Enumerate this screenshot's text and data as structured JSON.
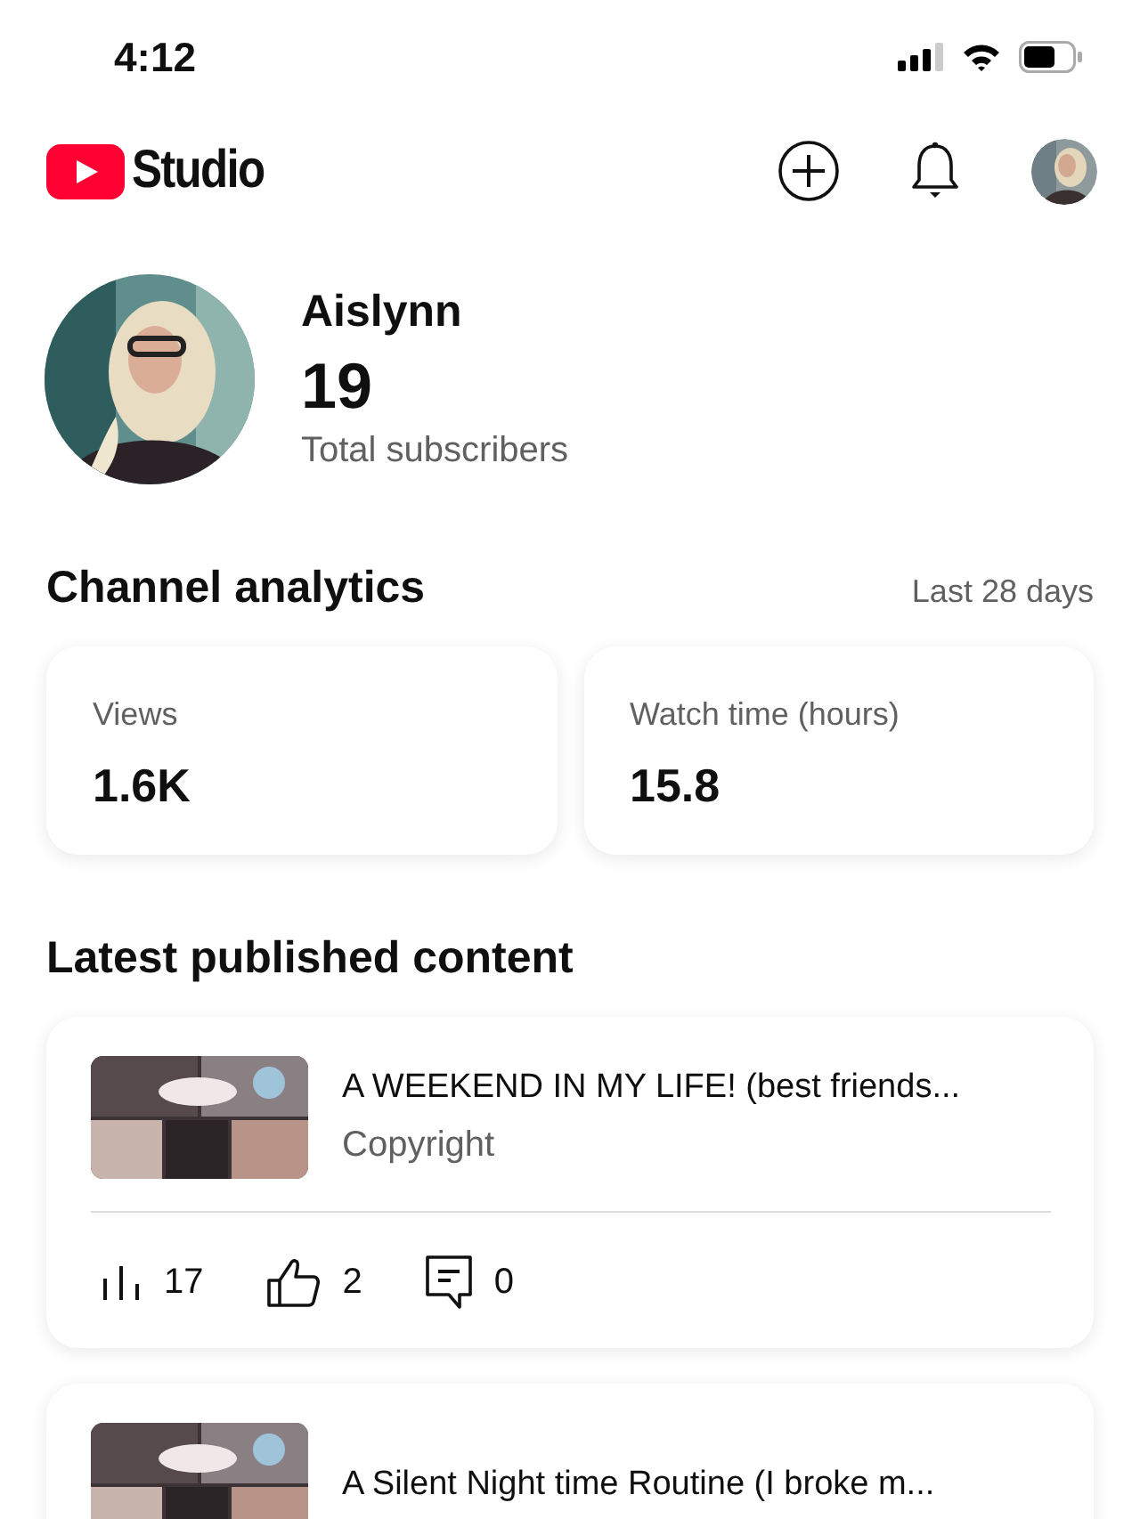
{
  "status_bar": {
    "time": "4:12"
  },
  "header": {
    "logo_text": "Studio"
  },
  "channel": {
    "name": "Aislynn",
    "subscribers": "19",
    "subscribers_label": "Total subscribers"
  },
  "analytics": {
    "title": "Channel analytics",
    "period": "Last 28 days",
    "cards": [
      {
        "label": "Views",
        "value": "1.6K"
      },
      {
        "label": "Watch time (hours)",
        "value": "15.8"
      }
    ]
  },
  "latest": {
    "title": "Latest published content",
    "videos": [
      {
        "title": "A WEEKEND IN MY LIFE! (best friends...",
        "note": "Copyright",
        "stats": [
          {
            "kind": "views",
            "value": "17"
          },
          {
            "kind": "likes",
            "value": "2"
          },
          {
            "kind": "comments",
            "value": "0"
          }
        ]
      },
      {
        "title": "A Silent Night time Routine (I broke m..."
      }
    ]
  }
}
